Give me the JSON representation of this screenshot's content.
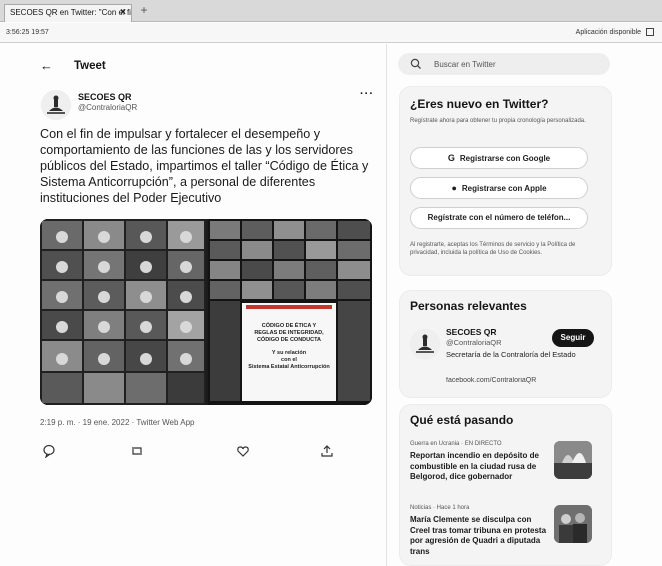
{
  "browser": {
    "tab_title": "SECOES QR en Twitter: \"Con el fi",
    "tab_close": "×",
    "new_tab": "+",
    "url_left": "3:56:25 19:57",
    "url_right": "Aplicación disponible"
  },
  "tweet": {
    "back_icon": "←",
    "header_title": "Tweet",
    "author_name": "SECOES QR",
    "author_handle": "@ContraloriaQR",
    "more_icon": "···",
    "text": "Con el fin de impulsar y fortalecer el desempeño y comportamiento de las funciones de las y los servidores públicos del Estado, impartimos el taller “Código de Ética y Sistema Anticorrupción”, a personal de diferentes instituciones del Poder Ejecutivo",
    "meta": "2:19 p. m. · 19 ene. 2022 · Twitter Web App",
    "slide_line1": "CÓDIGO DE ÉTICA Y",
    "slide_line2": "REGLAS DE INTEGRIDAD,",
    "slide_line3": "CÓDIGO DE CONDUCTA",
    "slide_line4": "Y su relación",
    "slide_line5": "con el",
    "slide_line6": "Sistema Estatal Anticorrupción"
  },
  "actions": {
    "reply_icon": "reply-icon",
    "retweet_icon": "retweet-icon",
    "like_icon": "like-icon",
    "share_icon": "share-icon"
  },
  "sidebar": {
    "search_placeholder": "Buscar en Twitter",
    "new_title": "¿Eres nuevo en Twitter?",
    "new_text": "Regístrate ahora para obtener tu propia cronología personalizada.",
    "google_btn": "Registrarse con Google",
    "apple_btn": "Registrarse con Apple",
    "phone_btn": "Regístrate con el número de teléfon...",
    "terms_text": "Al registrarte, aceptas los Términos de servicio y la Política de privacidad, incluida la política de Uso de Cookies.",
    "relevant_title": "Personas relevantes",
    "rel_name": "SECOES QR",
    "rel_handle": "@ContraloriaQR",
    "rel_bio": "Secretaría de la Contraloría del Estado",
    "rel_link": "facebook.com/ContraloriaQR",
    "follow_btn": "Seguir",
    "trends_title": "Qué está pasando",
    "trend1_meta": "Guerra en Ucrania · EN DIRECTO",
    "trend1_title": "Reportan incendio en depósito de combustible en la ciudad rusa de Belgorod, dice gobernador",
    "trend2_meta": "Noticias · Hace 1 hora",
    "trend2_title": "María Clemente se disculpa con Creel tras tomar tribuna en protesta por agresión de Quadri a diputada trans"
  },
  "colors": {
    "accent": "#151515",
    "panel_bg": "#f4f4f4",
    "text_secondary": "#555555"
  }
}
